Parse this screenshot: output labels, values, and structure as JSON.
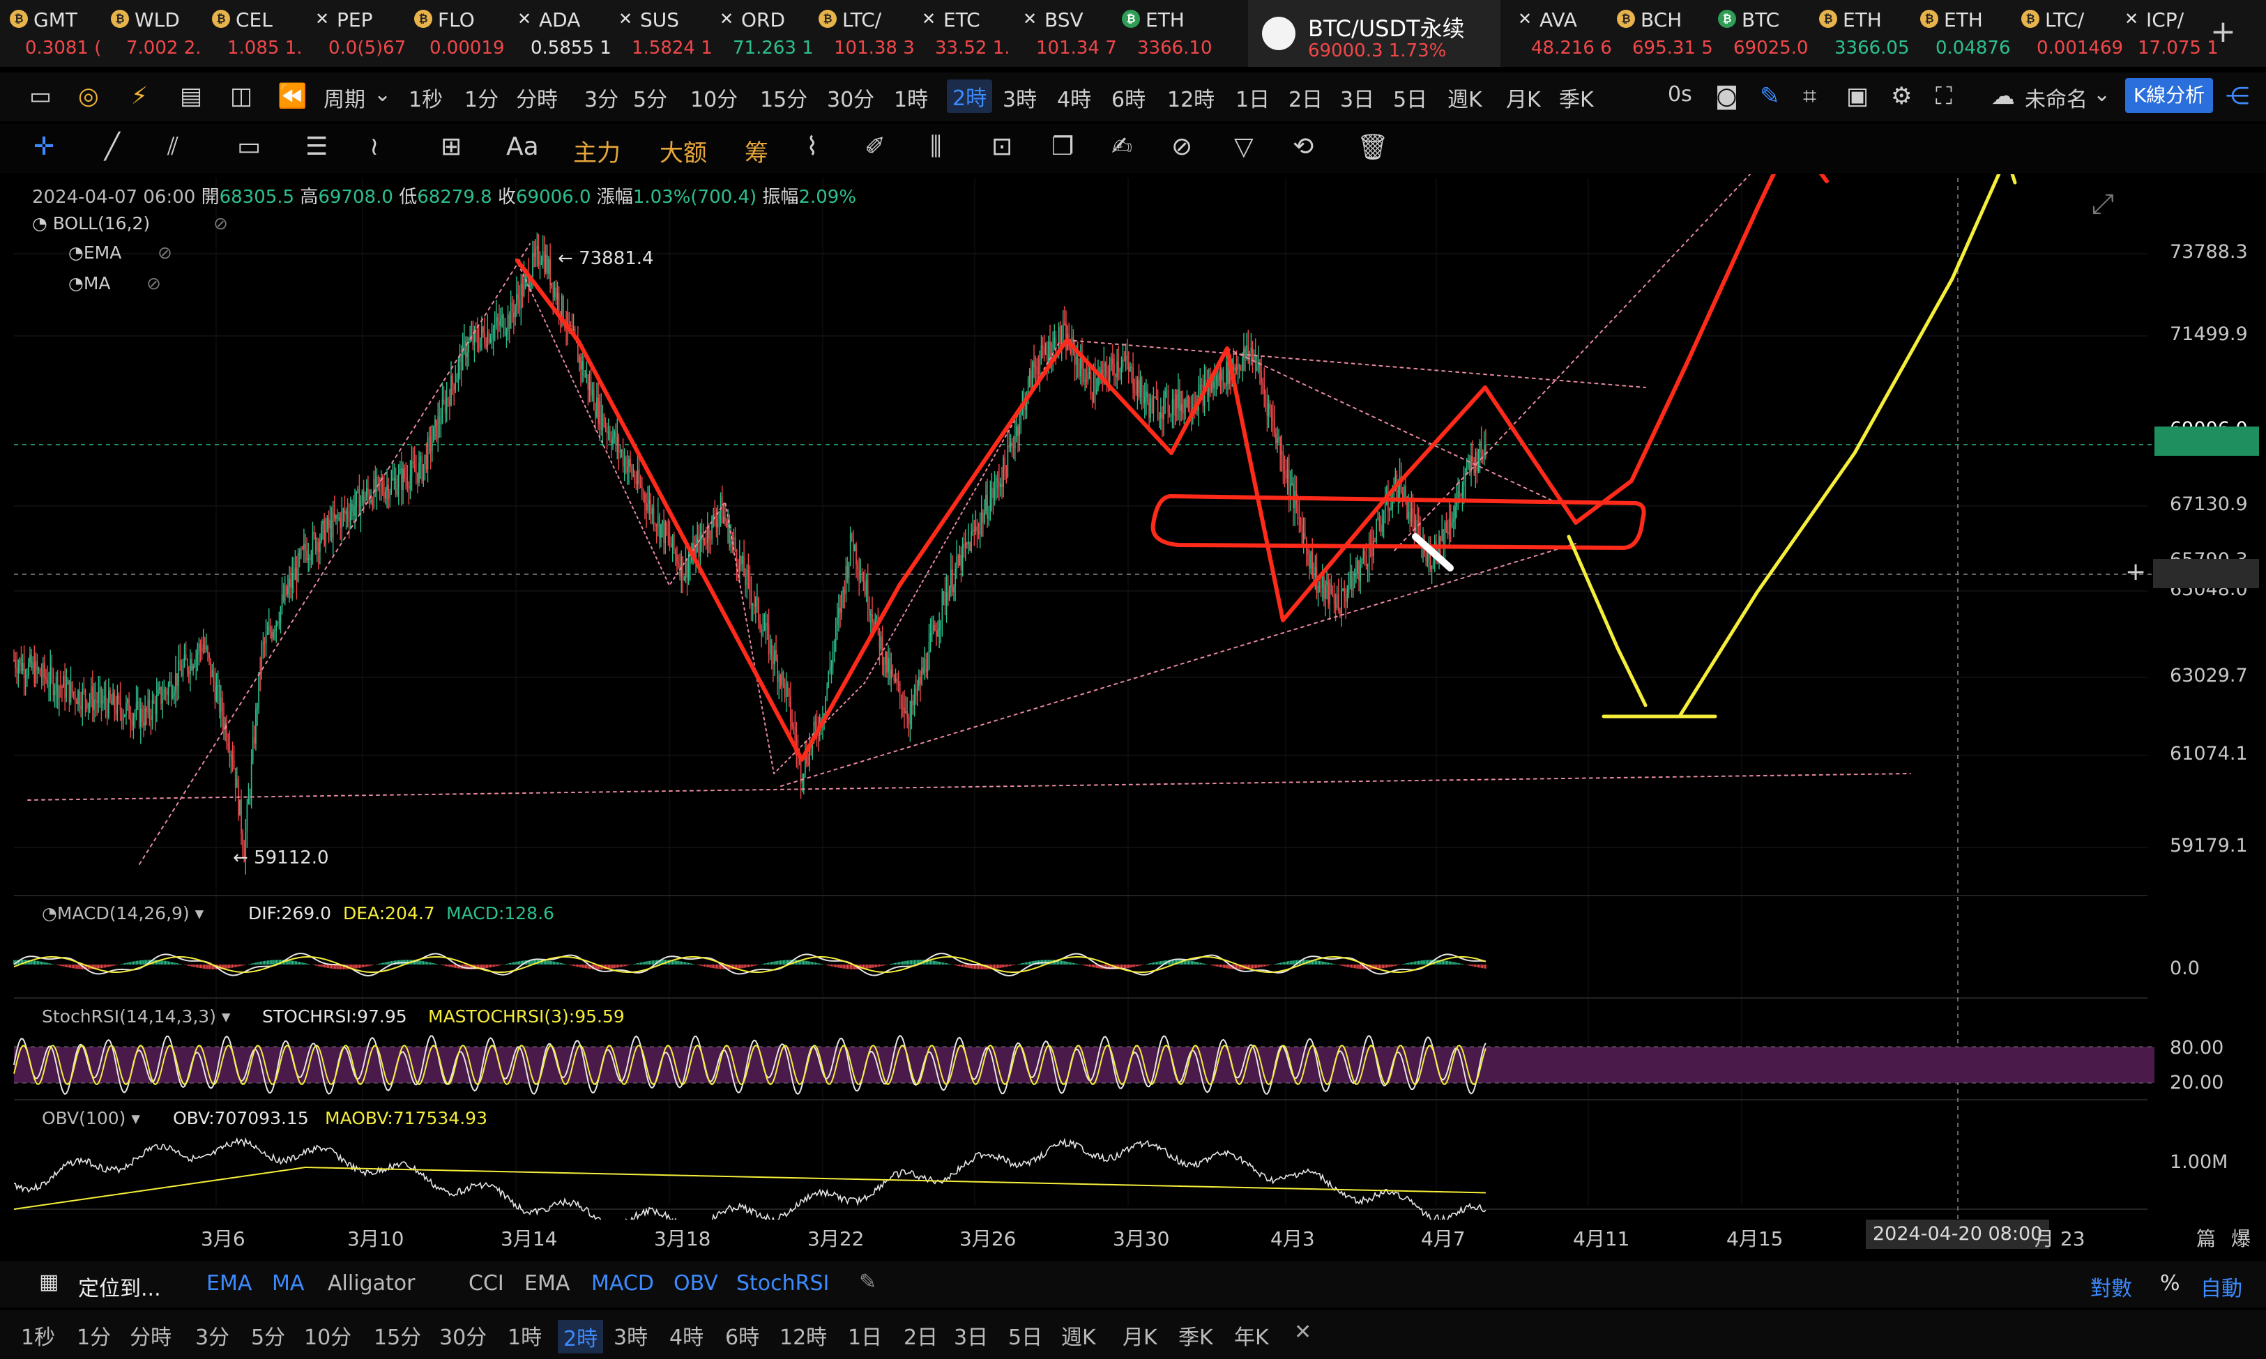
{
  "ticker": [
    {
      "sym": "GMT",
      "price": "0.3081 (",
      "dir": "dn",
      "icon": "coin-icon"
    },
    {
      "sym": "WLD",
      "price": "7.002 2.",
      "dir": "dn",
      "icon": "coin-icon"
    },
    {
      "sym": "CEL",
      "price": "1.085 1.",
      "dir": "dn",
      "icon": "coin-icon"
    },
    {
      "sym": "PEP",
      "price": "0.0(5)67",
      "dir": "dn",
      "icon": "x-icon"
    },
    {
      "sym": "FLO",
      "price": "0.00019",
      "dir": "dn",
      "icon": "coin-icon"
    },
    {
      "sym": "ADA",
      "price": "0.5855 1",
      "dir": "wh",
      "icon": "x-icon"
    },
    {
      "sym": "SUS",
      "price": "1.5824 1",
      "dir": "dn",
      "icon": "x-icon"
    },
    {
      "sym": "ORD",
      "price": "71.263 1",
      "dir": "up",
      "icon": "x-icon"
    },
    {
      "sym": "LTC/",
      "price": "101.38 3",
      "dir": "dn",
      "icon": "coin-icon"
    },
    {
      "sym": "ETC",
      "price": "33.52 1.",
      "dir": "dn",
      "icon": "x-icon"
    },
    {
      "sym": "BSV",
      "price": "101.34 7",
      "dir": "dn",
      "icon": "x-icon"
    },
    {
      "sym": "ETH",
      "price": "3366.10",
      "dir": "dn",
      "icon": "green-coin-icon"
    }
  ],
  "ticker_active": {
    "sym": "BTC/USDT永续",
    "price": "69000.3  1.73%"
  },
  "ticker_right": [
    {
      "sym": "AVA",
      "price": "48.216 6",
      "dir": "dn",
      "icon": "x-icon"
    },
    {
      "sym": "BCH",
      "price": "695.31 5",
      "dir": "dn",
      "icon": "coin-icon"
    },
    {
      "sym": "BTC",
      "price": "69025.0",
      "dir": "dn",
      "icon": "green-coin-icon"
    },
    {
      "sym": "ETH",
      "price": "3366.05",
      "dir": "up",
      "icon": "coin-icon"
    },
    {
      "sym": "ETH",
      "price": "0.04876",
      "dir": "up",
      "icon": "coin-icon"
    },
    {
      "sym": "LTC/",
      "price": "0.001469",
      "dir": "dn",
      "icon": "coin-icon"
    },
    {
      "sym": "ICP/",
      "price": "17.075 1",
      "dir": "dn",
      "icon": "x-icon"
    }
  ],
  "toolbar": {
    "period_label": "周期",
    "intervals": [
      "1秒",
      "1分",
      "分時",
      "3分",
      "5分",
      "10分",
      "15分",
      "30分",
      "1時",
      "2時",
      "3時",
      "4時",
      "6時",
      "12時",
      "1日",
      "2日",
      "3日",
      "5日",
      "週K",
      "月K",
      "季K"
    ],
    "selected_interval": "2時",
    "countdown": "0s",
    "layout_name": "未命名",
    "kline_btn": "K線分析"
  },
  "draw_toolbar": {
    "text_tool": "Aa",
    "t1": "主力",
    "t2": "大额",
    "t3": "筹"
  },
  "ohlc": {
    "date": "2024-04-07 06:00",
    "open_label": "開",
    "open": "68305.5",
    "high_label": "高",
    "high": "69708.0",
    "low_label": "低",
    "low": "68279.8",
    "close_label": "收",
    "close": "69006.0",
    "chg_label": "漲幅",
    "chg": "1.03%(700.4)",
    "amp_label": "振幅",
    "amp": "2.09%"
  },
  "indicators": {
    "boll": "BOLL(16,2)",
    "ema": "EMA",
    "ma": "MA"
  },
  "annotations": {
    "high": "73881.4",
    "low": "59112.0"
  },
  "price_axis": [
    "73788.3",
    "71499.9",
    "69006.0",
    "67130.9",
    "65790.3",
    "65048.0",
    "63029.7",
    "61074.1",
    "59179.1"
  ],
  "macd": {
    "title": "MACD(14,26,9)",
    "dif": "DIF:269.0",
    "dea": "DEA:204.7",
    "macd": "MACD:128.6",
    "axis": "0.0"
  },
  "stoch": {
    "title": "StochRSI(14,14,3,3)",
    "k": "STOCHRSI:97.95",
    "d": "MASTOCHRSI(3):95.59",
    "axis_hi": "80.00",
    "axis_lo": "20.00"
  },
  "obv": {
    "title": "OBV(100)",
    "obv": "OBV:707093.15",
    "ma": "MAOBV:717534.93",
    "axis": "1.00M"
  },
  "time_axis": [
    "3月6",
    "3月10",
    "3月14",
    "3月18",
    "3月22",
    "3月26",
    "3月30",
    "4月3",
    "4月7",
    "4月11",
    "4月15"
  ],
  "time_cursor": "2024-04-20 08:00",
  "time_axis_tail": "月 23",
  "axis_corner": [
    "篇",
    "爆"
  ],
  "bottom_bar": {
    "locate": "定位到...",
    "items": [
      "EMA",
      "MA",
      "Alligator",
      "CCI",
      "EMA",
      "MACD",
      "OBV",
      "StochRSI"
    ],
    "right": [
      "對數",
      "%",
      "自動"
    ]
  },
  "bottom_intervals": [
    "1秒",
    "1分",
    "分時",
    "3分",
    "5分",
    "10分",
    "15分",
    "30分",
    "1時",
    "2時",
    "3時",
    "4時",
    "6時",
    "12時",
    "1日",
    "2日",
    "3日",
    "5日",
    "週K",
    "月K",
    "季K",
    "年K"
  ],
  "bottom_selected": "2時",
  "colors": {
    "up": "#2dc08c",
    "down": "#f0484a",
    "accent": "#3d8bff",
    "draw_red": "#ff2a1a",
    "draw_yellow": "#f5ee3a"
  },
  "chart_data": {
    "type": "candlestick",
    "price_points": [
      [
        0,
        63800
      ],
      [
        40,
        63000
      ],
      [
        90,
        62400
      ],
      [
        130,
        64200
      ],
      [
        150,
        61500
      ],
      [
        158,
        59112
      ],
      [
        170,
        64000
      ],
      [
        200,
        66500
      ],
      [
        240,
        67800
      ],
      [
        280,
        68500
      ],
      [
        310,
        71500
      ],
      [
        340,
        72200
      ],
      [
        355,
        73400
      ],
      [
        362,
        73881
      ],
      [
        380,
        72000
      ],
      [
        400,
        70000
      ],
      [
        430,
        68000
      ],
      [
        460,
        66000
      ],
      [
        485,
        67500
      ],
      [
        510,
        65000
      ],
      [
        530,
        63000
      ],
      [
        540,
        61074
      ],
      [
        555,
        62500
      ],
      [
        575,
        66800
      ],
      [
        600,
        63500
      ],
      [
        615,
        62400
      ],
      [
        640,
        65500
      ],
      [
        680,
        68500
      ],
      [
        700,
        71000
      ],
      [
        720,
        71800
      ],
      [
        740,
        70500
      ],
      [
        760,
        71200
      ],
      [
        780,
        70000
      ],
      [
        810,
        70200
      ],
      [
        850,
        71400
      ],
      [
        865,
        69500
      ],
      [
        880,
        67500
      ],
      [
        895,
        65600
      ],
      [
        910,
        65200
      ],
      [
        930,
        66500
      ],
      [
        950,
        68200
      ],
      [
        970,
        66200
      ],
      [
        985,
        67200
      ],
      [
        1000,
        68600
      ],
      [
        1010,
        69006
      ]
    ]
  }
}
